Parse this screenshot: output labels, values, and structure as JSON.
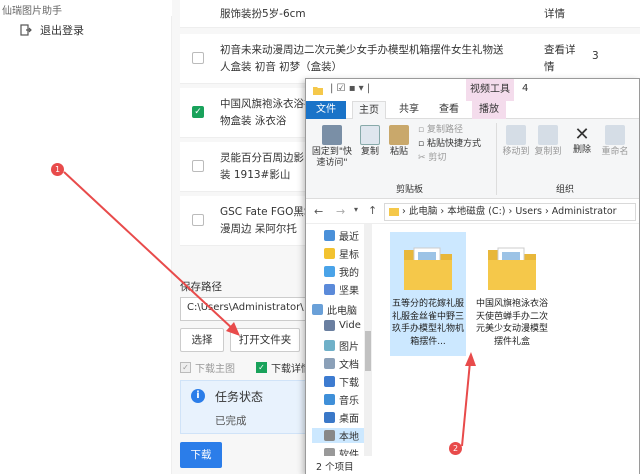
{
  "app": {
    "title": "仙瑞图片助手",
    "logout": "退出登录"
  },
  "rows": [
    {
      "text": "服饰装扮5岁-6cm",
      "action": "详情",
      "count": "",
      "checked": false
    },
    {
      "text": "初音未来动漫周边二次元美少女手办模型机箱摆件女生礼物送人盒装 初音 初梦（盒装）",
      "action": "查看详情",
      "count": "3",
      "checked": false
    },
    {
      "text": "中国风旗袍泳衣浴衣 件礼物盒装 泳衣浴",
      "action": "",
      "count": "",
      "checked": true
    },
    {
      "text": "灵能百分百周边影山 办盒装 1913#影山",
      "action": "",
      "count": "",
      "checked": false
    },
    {
      "text": "GSC Fate FGO黑Sa 动漫周边 呆阿尔托",
      "action": "",
      "count": "",
      "checked": false
    }
  ],
  "save": {
    "label": "保存路径",
    "path": "C:\\Users\\Administrator\\",
    "choose": "选择",
    "open_folder": "打开文件夹",
    "opt_main": "下载主图",
    "opt_detail": "下载详情"
  },
  "task": {
    "title": "任务状态",
    "status": "已完成"
  },
  "download": "下载",
  "markers": {
    "m1": "1",
    "m2": "2"
  },
  "explorer": {
    "title_num": "4",
    "tools_tab": "视频工具",
    "tabs": [
      "文件",
      "主页",
      "共享",
      "查看",
      "播放"
    ],
    "ribbon": {
      "pin": "固定到\"快速访问\"",
      "copy": "复制",
      "paste": "粘贴",
      "copy_path": "复制路径",
      "paste_shortcut": "粘贴快捷方式",
      "cut": "剪切",
      "move_to": "移动到",
      "copy_to": "复制到",
      "delete": "删除",
      "rename": "重命名",
      "clipboard": "剪贴板",
      "organize": "组织"
    },
    "address": [
      "此电脑",
      "本地磁盘 (C:)",
      "Users",
      "Administrator"
    ],
    "nav": [
      "最近",
      "星标",
      "我的",
      "坚果",
      "此电脑",
      "Vide",
      "图片",
      "文档",
      "下载",
      "音乐",
      "桌面",
      "本地",
      "软件"
    ],
    "files": [
      {
        "name": "五等分的花嫁礼服礼服金丝雀中野三玖手办模型礼物机箱摆件..."
      },
      {
        "name": "中国风旗袍泳衣浴天使芭蝉手办二次元美少女动漫模型摆件礼盒"
      }
    ],
    "status": "2 个项目"
  },
  "colors": {
    "accent": "#2b7de9",
    "green": "#19a25b",
    "arrow": "#e84b4b",
    "folder": "#f5c84a"
  }
}
